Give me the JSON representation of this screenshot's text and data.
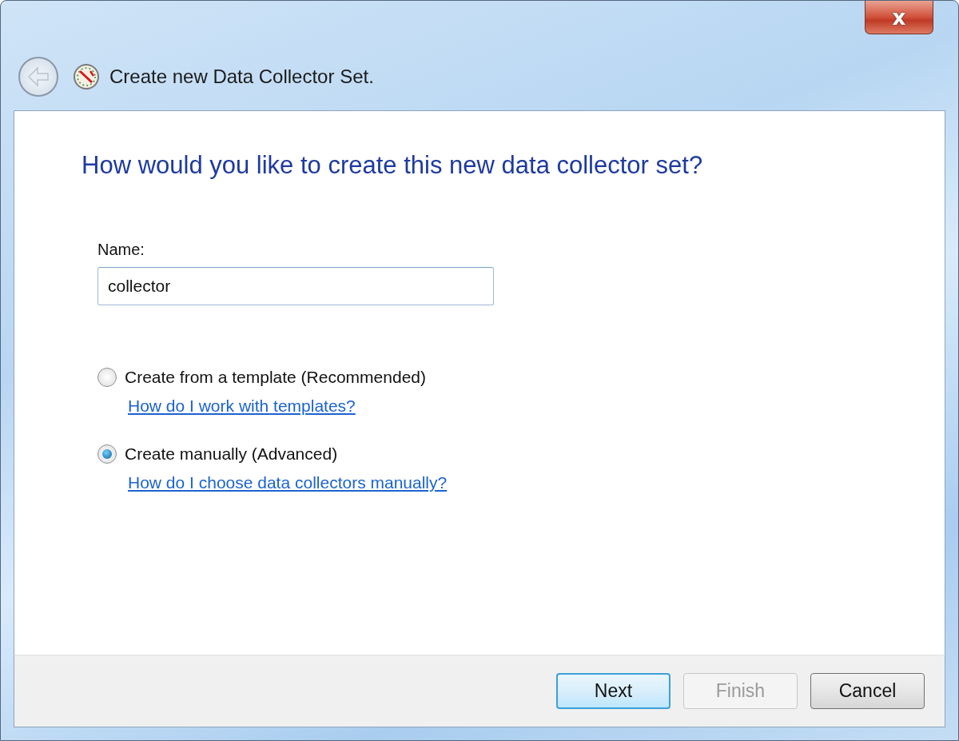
{
  "window": {
    "title": "Create new Data Collector Set.",
    "close_label": "x"
  },
  "heading": "How would you like to create this new data collector set?",
  "name_field": {
    "label": "Name:",
    "value": "collector"
  },
  "options": [
    {
      "label": "Create from a template (Recommended)",
      "selected": false,
      "link": "How do I work with templates?"
    },
    {
      "label": "Create manually (Advanced)",
      "selected": true,
      "link": "How do I choose data collectors manually?"
    }
  ],
  "buttons": [
    {
      "label": "Next",
      "default": true,
      "disabled": false
    },
    {
      "label": "Finish",
      "default": false,
      "disabled": true
    },
    {
      "label": "Cancel",
      "default": false,
      "disabled": false
    }
  ]
}
